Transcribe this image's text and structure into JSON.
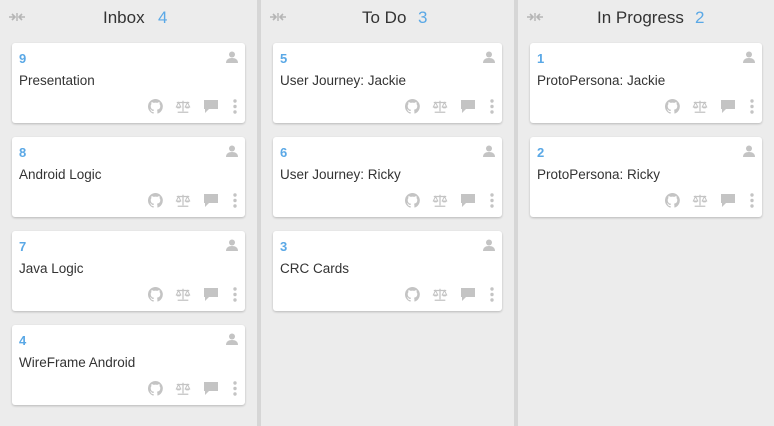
{
  "columns": [
    {
      "title": "Inbox",
      "count": "4",
      "cards": [
        {
          "number": "9",
          "title": "Presentation"
        },
        {
          "number": "8",
          "title": "Android Logic"
        },
        {
          "number": "7",
          "title": "Java Logic"
        },
        {
          "number": "4",
          "title": "WireFrame Android"
        }
      ]
    },
    {
      "title": "To Do",
      "count": "3",
      "cards": [
        {
          "number": "5",
          "title": "User Journey: Jackie"
        },
        {
          "number": "6",
          "title": "User Journey: Ricky"
        },
        {
          "number": "3",
          "title": "CRC Cards"
        }
      ]
    },
    {
      "title": "In Progress",
      "count": "2",
      "cards": [
        {
          "number": "1",
          "title": "ProtoPersona: Jackie"
        },
        {
          "number": "2",
          "title": "ProtoPersona: Ricky"
        }
      ]
    }
  ],
  "icons": {
    "collapse": "collapse-arrows-icon",
    "assignee": "user-icon",
    "repo": "github-icon",
    "estimate": "scale-icon",
    "comments": "comment-icon",
    "more": "more-vertical-icon"
  },
  "colors": {
    "accent": "#5aa8e6",
    "icon": "#c4c4c4",
    "background": "#ececec",
    "card": "#ffffff"
  }
}
